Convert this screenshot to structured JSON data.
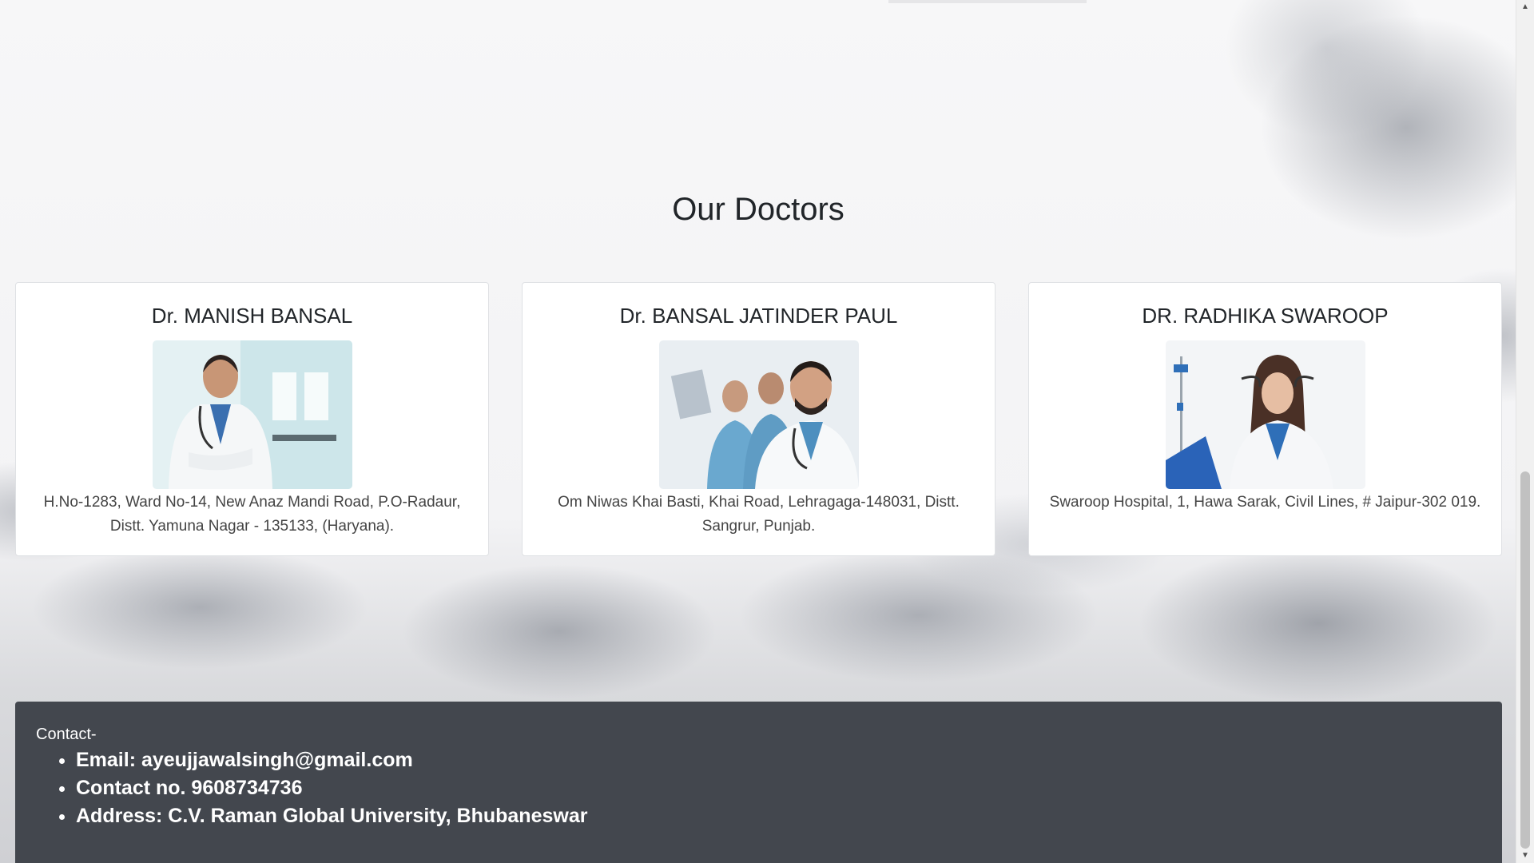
{
  "section": {
    "title": "Our Doctors"
  },
  "doctors": [
    {
      "name": "Dr. MANISH BANSAL",
      "address": "H.No-1283, Ward No-14, New Anaz Mandi Road, P.O-Radaur, Distt. Yamuna Nagar - 135133, (Haryana)."
    },
    {
      "name": "Dr. BANSAL JATINDER PAUL",
      "address": "Om Niwas Khai Basti, Khai Road, Lehragaga-148031, Distt. Sangrur, Punjab."
    },
    {
      "name": "DR. RADHIKA SWAROOP",
      "address": "Swaroop Hospital, 1, Hawa Sarak, Civil Lines, # Jaipur-302 019."
    }
  ],
  "footer": {
    "label": "Contact-",
    "items": [
      "Email: ayeujjawalsingh@gmail.com",
      "Contact no. 9608734736",
      "Address: C.V. Raman Global University, Bhubaneswar"
    ]
  },
  "colors": {
    "footer_bg": "#43474e",
    "card_bg": "#ffffff",
    "page_bg": "#f4f4f6"
  }
}
